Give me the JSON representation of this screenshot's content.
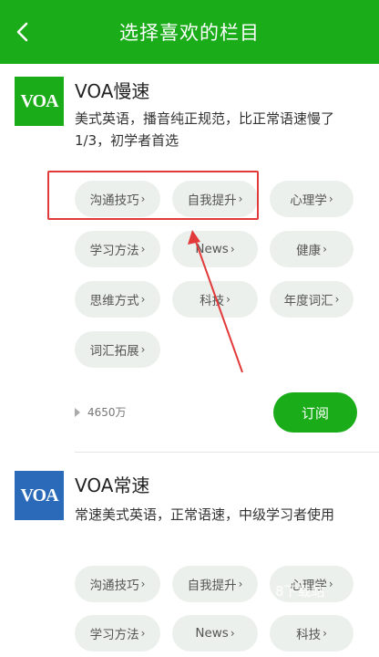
{
  "header": {
    "title": "选择喜欢的栏目",
    "back_icon": "chevron-left-icon"
  },
  "programs": [
    {
      "logo_text": "VOA",
      "logo_color": "#1aad19",
      "name": "VOA慢速",
      "description": "美式英语，播音纯正规范，比正常语速慢了1/3，初学者首选",
      "tags": [
        "沟通技巧",
        "自我提升",
        "心理学",
        "学习方法",
        "News",
        "健康",
        "思维方式",
        "科技",
        "年度词汇",
        "词汇拓展"
      ],
      "listen_count": "4650万",
      "subscribe_label": "订阅"
    },
    {
      "logo_text": "VOA",
      "logo_color": "#2a6ab8",
      "name": "VOA常速",
      "description": "常速美式英语，正常语速，中级学习者使用",
      "tags": [
        "沟通技巧",
        "自我提升",
        "心理学",
        "学习方法",
        "News",
        "科技"
      ]
    }
  ],
  "arrow_glyph": "›",
  "watermark": "8下载站",
  "colors": {
    "brand": "#1aad19",
    "annotation": "#e23a3a"
  }
}
